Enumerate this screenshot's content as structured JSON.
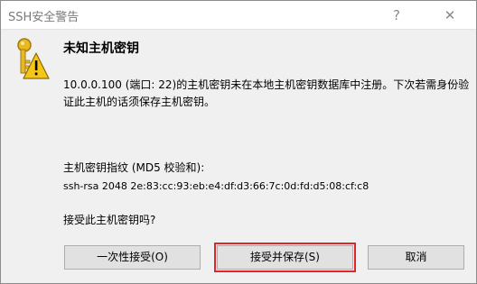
{
  "window": {
    "title": "SSH安全警告",
    "help_glyph": "?",
    "close_glyph": "✕"
  },
  "icon": "key-warning-icon",
  "dialog": {
    "heading": "未知主机密钥",
    "message": "10.0.0.100 (端口: 22)的主机密钥未在本地主机密钥数据库中注册。下次若需身份验证此主机的话须保存主机密钥。",
    "fingerprint_label": "主机密钥指纹 (MD5 校验和):",
    "fingerprint_value": "ssh-rsa 2048 2e:83:cc:93:eb:e4:df:d3:66:7c:0d:fd:d5:08:cf:c8",
    "question": "接受此主机密钥吗?"
  },
  "buttons": {
    "accept_once": "一次性接受(O)",
    "accept_save": "接受并保存(S)",
    "cancel": "取消"
  },
  "colors": {
    "highlight": "#e0262b",
    "button_bg": "#e1e1e1",
    "dialog_bg": "#f0f0f0"
  }
}
